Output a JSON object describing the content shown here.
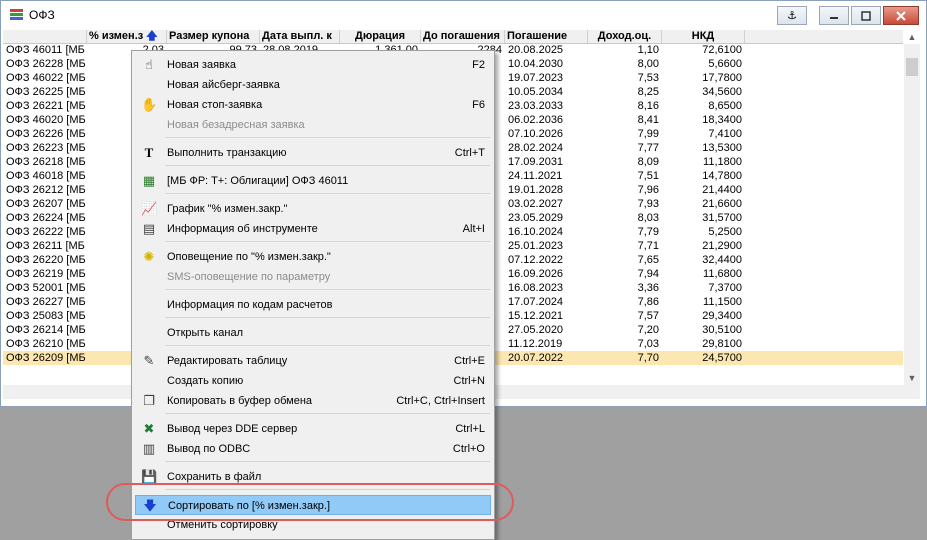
{
  "window": {
    "title": "ОФЗ",
    "buttons": {
      "pin_icon": "anchor-icon",
      "minimize_icon": "minimize-icon",
      "maximize_icon": "maximize-icon",
      "close_icon": "close-icon"
    }
  },
  "table": {
    "columns": [
      "% измен.з",
      "Размер купона",
      "Дата выпл. к",
      "Дюрация",
      "До погашения",
      "Погашение",
      "Доход.оц.",
      "НКД"
    ],
    "sort_icon": "sort-up-arrow-icon",
    "first_row": {
      "name": "ОФЗ 46011 [МБ",
      "change": "2,03",
      "coupon": "99,73",
      "pay_date": "28.08.2019",
      "duration": "1 361,00",
      "days": "2284",
      "maturity": "20.08.2025",
      "yield": "1,10",
      "nkd": "72,6100"
    },
    "rows": [
      {
        "name": "ОФЗ 26228 [МБ",
        "maturity": "10.04.2030",
        "yield": "8,00",
        "nkd": "5,6600"
      },
      {
        "name": "ОФЗ 46022 [МБ",
        "maturity": "19.07.2023",
        "yield": "7,53",
        "nkd": "17,7800"
      },
      {
        "name": "ОФЗ 26225 [МБ",
        "maturity": "10.05.2034",
        "yield": "8,25",
        "nkd": "34,5600"
      },
      {
        "name": "ОФЗ 26221 [МБ",
        "maturity": "23.03.2033",
        "yield": "8,16",
        "nkd": "8,6500"
      },
      {
        "name": "ОФЗ 46020 [МБ",
        "maturity": "06.02.2036",
        "yield": "8,41",
        "nkd": "18,3400"
      },
      {
        "name": "ОФЗ 26226 [МБ",
        "maturity": "07.10.2026",
        "yield": "7,99",
        "nkd": "7,4100"
      },
      {
        "name": "ОФЗ 26223 [МБ",
        "maturity": "28.02.2024",
        "yield": "7,77",
        "nkd": "13,5300"
      },
      {
        "name": "ОФЗ 26218 [МБ",
        "maturity": "17.09.2031",
        "yield": "8,09",
        "nkd": "11,1800"
      },
      {
        "name": "ОФЗ 46018 [МБ",
        "maturity": "24.11.2021",
        "yield": "7,51",
        "nkd": "14,7800"
      },
      {
        "name": "ОФЗ 26212 [МБ",
        "maturity": "19.01.2028",
        "yield": "7,96",
        "nkd": "21,4400"
      },
      {
        "name": "ОФЗ 26207 [МБ",
        "maturity": "03.02.2027",
        "yield": "7,93",
        "nkd": "21,6600"
      },
      {
        "name": "ОФЗ 26224 [МБ",
        "maturity": "23.05.2029",
        "yield": "8,03",
        "nkd": "31,5700"
      },
      {
        "name": "ОФЗ 26222 [МБ",
        "maturity": "16.10.2024",
        "yield": "7,79",
        "nkd": "5,2500"
      },
      {
        "name": "ОФЗ 26211 [МБ",
        "maturity": "25.01.2023",
        "yield": "7,71",
        "nkd": "21,2900"
      },
      {
        "name": "ОФЗ 26220 [МБ",
        "maturity": "07.12.2022",
        "yield": "7,65",
        "nkd": "32,4400"
      },
      {
        "name": "ОФЗ 26219 [МБ",
        "maturity": "16.09.2026",
        "yield": "7,94",
        "nkd": "11,6800"
      },
      {
        "name": "ОФЗ 52001 [МБ",
        "maturity": "16.08.2023",
        "yield": "3,36",
        "nkd": "7,3700"
      },
      {
        "name": "ОФЗ 26227 [МБ",
        "maturity": "17.07.2024",
        "yield": "7,86",
        "nkd": "11,1500"
      },
      {
        "name": "ОФЗ 25083 [МБ",
        "maturity": "15.12.2021",
        "yield": "7,57",
        "nkd": "29,3400"
      },
      {
        "name": "ОФЗ 26214 [МБ",
        "maturity": "27.05.2020",
        "yield": "7,20",
        "nkd": "30,5100"
      },
      {
        "name": "ОФЗ 26210 [МБ",
        "maturity": "11.12.2019",
        "yield": "7,03",
        "nkd": "29,8100"
      },
      {
        "name": "ОФЗ 26209 [МБ",
        "maturity": "20.07.2022",
        "yield": "7,70",
        "nkd": "24,5700"
      }
    ]
  },
  "menu": {
    "items": [
      {
        "label": "Новая заявка",
        "shortcut": "F2",
        "icon": "hand-icon",
        "disabled": false
      },
      {
        "label": "Новая айсберг-заявка",
        "shortcut": "",
        "icon": "",
        "disabled": false
      },
      {
        "label": "Новая стоп-заявка",
        "shortcut": "F6",
        "icon": "stop-hand-icon",
        "disabled": false
      },
      {
        "label": "Новая безадресная заявка",
        "shortcut": "",
        "icon": "",
        "disabled": true
      },
      {
        "label": "Выполнить транзакцию",
        "shortcut": "Ctrl+T",
        "icon": "transaction-icon",
        "disabled": false
      },
      {
        "label": "[МБ ФР: Т+: Облигации] ОФЗ 46011",
        "shortcut": "",
        "icon": "instrument-icon",
        "disabled": false
      },
      {
        "label": "График \"% измен.закр.\"",
        "shortcut": "",
        "icon": "chart-icon",
        "disabled": false
      },
      {
        "label": "Информация об инструменте",
        "shortcut": "Alt+I",
        "icon": "info-icon",
        "disabled": false
      },
      {
        "label": "Оповещение по \"% измен.закр.\"",
        "shortcut": "",
        "icon": "alert-icon",
        "disabled": false
      },
      {
        "label": "SMS-оповещение по параметру",
        "shortcut": "",
        "icon": "",
        "disabled": true
      },
      {
        "label": "Информация по кодам расчетов",
        "shortcut": "",
        "icon": "",
        "disabled": false
      },
      {
        "label": "Открыть канал",
        "shortcut": "",
        "icon": "",
        "disabled": false
      },
      {
        "label": "Редактировать таблицу",
        "shortcut": "Ctrl+E",
        "icon": "edit-table-icon",
        "disabled": false
      },
      {
        "label": "Создать копию",
        "shortcut": "Ctrl+N",
        "icon": "",
        "disabled": false
      },
      {
        "label": "Копировать в буфер обмена",
        "shortcut": "Ctrl+C, Ctrl+Insert",
        "icon": "copy-icon",
        "disabled": false
      },
      {
        "label": "Вывод через DDE сервер",
        "shortcut": "Ctrl+L",
        "icon": "dde-excel-icon",
        "disabled": false
      },
      {
        "label": "Вывод по ODBC",
        "shortcut": "Ctrl+O",
        "icon": "odbc-icon",
        "disabled": false
      },
      {
        "label": "Сохранить в файл",
        "shortcut": "",
        "icon": "save-icon",
        "disabled": false
      },
      {
        "label": "Сортировать по [% измен.закр.]",
        "shortcut": "",
        "icon": "sort-down-arrow-icon",
        "disabled": false,
        "highlighted": true
      },
      {
        "label": "Отменить сортировку",
        "shortcut": "",
        "icon": "",
        "disabled": false
      }
    ]
  },
  "colors": {
    "selection_row": "#fce7b0",
    "menu_highlight": "#91c9f7",
    "annotation_ring": "#e05a5a"
  }
}
